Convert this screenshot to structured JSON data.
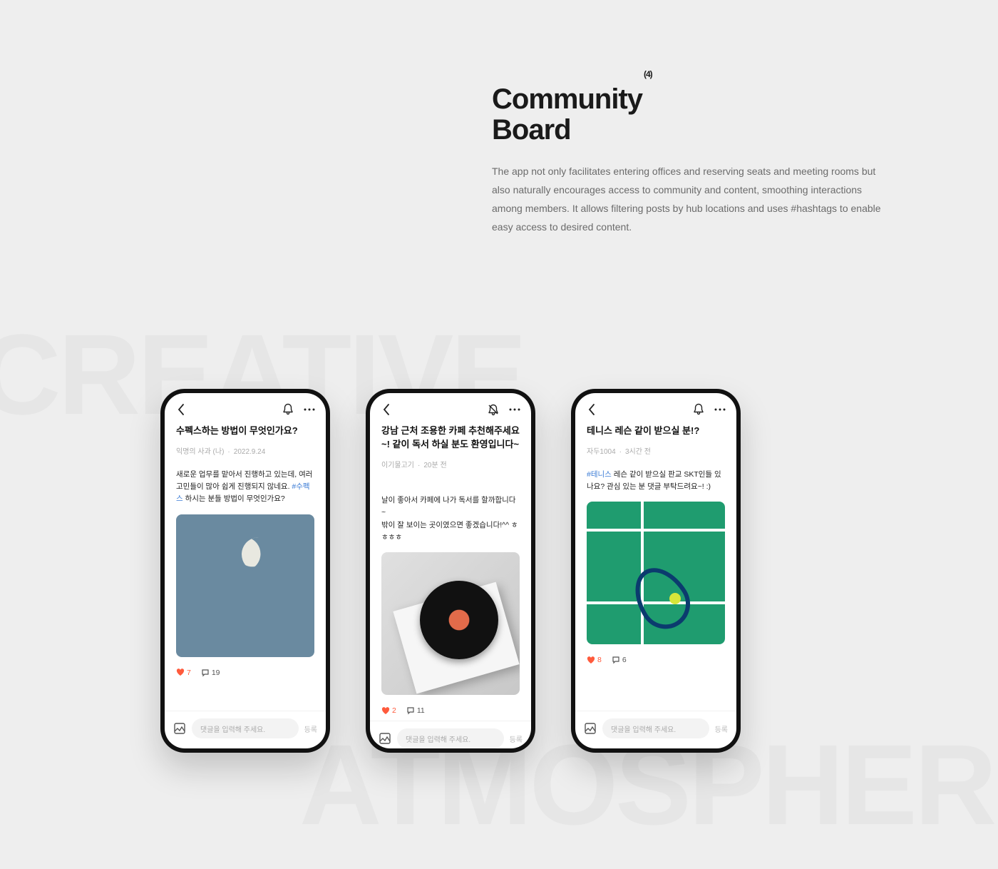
{
  "background": {
    "word1": "CREATIVE",
    "word2": "ATMOSPHERE"
  },
  "heading": {
    "title_line1": "Community",
    "title_line2": "Board",
    "sup": "(4)",
    "description": "The app not only facilitates entering offices and reserving seats and meeting rooms but also naturally encourages access to community and content, smoothing interactions among members. It allows filtering posts by hub locations and uses #hashtags to enable easy access to desired content."
  },
  "comment_placeholder": "댓글을 입력해 주세요.",
  "submit_label": "등록",
  "phones": [
    {
      "has_notif_slash": false,
      "title": "수펙스하는 방법이 무엇인가요?",
      "author": "익명의 사과 (나)",
      "time": "2022.9.24",
      "body_pre": "새로운 업무를 맡아서 진행하고 있는데, 여러 고민들이 많아 쉽게 진행되지 않네요. ",
      "hashtag": "#수펙스",
      "body_post": " 하시는 분들 방법이 무엇인가요?",
      "likes": "7",
      "comments": "19"
    },
    {
      "has_notif_slash": true,
      "title": "강남 근처 조용한 카페 추천해주세요~! 같이 독서 하실 분도 환영입니다~",
      "author": "이기물고기",
      "time": "20분 전",
      "body_pre": "날이 좋아서 카페에 나가 독서를 할까합니다~\n밖이 잘 보이는 곳이였으면 좋겠습니다!^^ ㅎㅎㅎㅎ",
      "hashtag": "",
      "body_post": "",
      "likes": "2",
      "comments": "11"
    },
    {
      "has_notif_slash": false,
      "title": "테니스 레슨 같이 받으실 분!?",
      "author": "자두1004",
      "time": "3시간 전",
      "body_pre": "",
      "hashtag": "#테니스",
      "body_post": " 레슨 같이 받으실 판교 SKT인들 있나요? 관심 있는 분 댓글 부탁드려요~! :)",
      "likes": "8",
      "comments": "6"
    }
  ]
}
